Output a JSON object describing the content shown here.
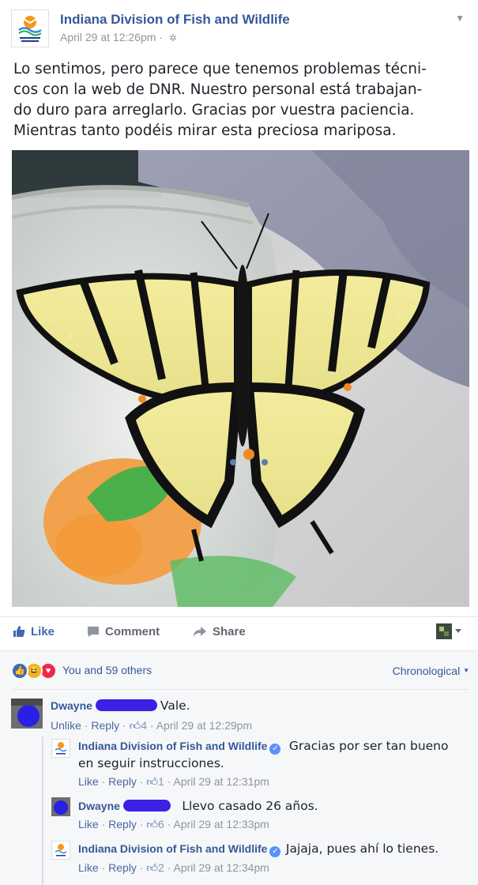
{
  "post": {
    "page_name": "Indiana Division of Fish and Wildlife",
    "timestamp": "April 29 at 12:26pm",
    "separator": "·",
    "audience_icon": "globe-icon",
    "menu_icon": "chevron-down-icon",
    "text_lines": [
      "Lo sentimos, pero parece que tenemos problemas técni-",
      "cos con la web de DNR. Nuestro personal está trabajan-",
      "do duro para arreglarlo. Gracias por vuestra paciencia.",
      "Mientras tanto podéis mirar esta preciosa mariposa."
    ]
  },
  "actions": {
    "like": "Like",
    "comment": "Comment",
    "share": "Share"
  },
  "reactions": {
    "icons": [
      "like-reaction-icon",
      "haha-reaction-icon",
      "love-reaction-icon"
    ],
    "summary": "You and 59 others",
    "sort": "Chronological"
  },
  "comments": [
    {
      "author": "Dwayne",
      "text": "Vale.",
      "actions": {
        "first": "Unlike",
        "reply": "Reply",
        "likes": "4",
        "time": "April 29 at 12:29pm"
      }
    },
    {
      "author": "Indiana Division of Fish and Wildlife",
      "text_line1": "Gracias por ser tan bueno",
      "text_line2": "en seguir instrucciones.",
      "actions": {
        "first": "Like",
        "reply": "Reply",
        "likes": "1",
        "time": "April 29 at 12:31pm"
      }
    },
    {
      "author": "Dwayne",
      "text": "Llevo casado 26 años.",
      "actions": {
        "first": "Like",
        "reply": "Reply",
        "likes": "6",
        "time": "April 29 at 12:33pm"
      }
    },
    {
      "author": "Indiana Division of Fish and Wildlife",
      "text": "Jajaja, pues ahí lo tienes.",
      "actions": {
        "first": "Like",
        "reply": "Reply",
        "likes": "2",
        "time": "April 29 at 12:34pm"
      }
    }
  ],
  "colors": {
    "link": "#365899",
    "meta": "#90949c",
    "censor": "#3b20e6",
    "like_blue": "#4267b2"
  }
}
